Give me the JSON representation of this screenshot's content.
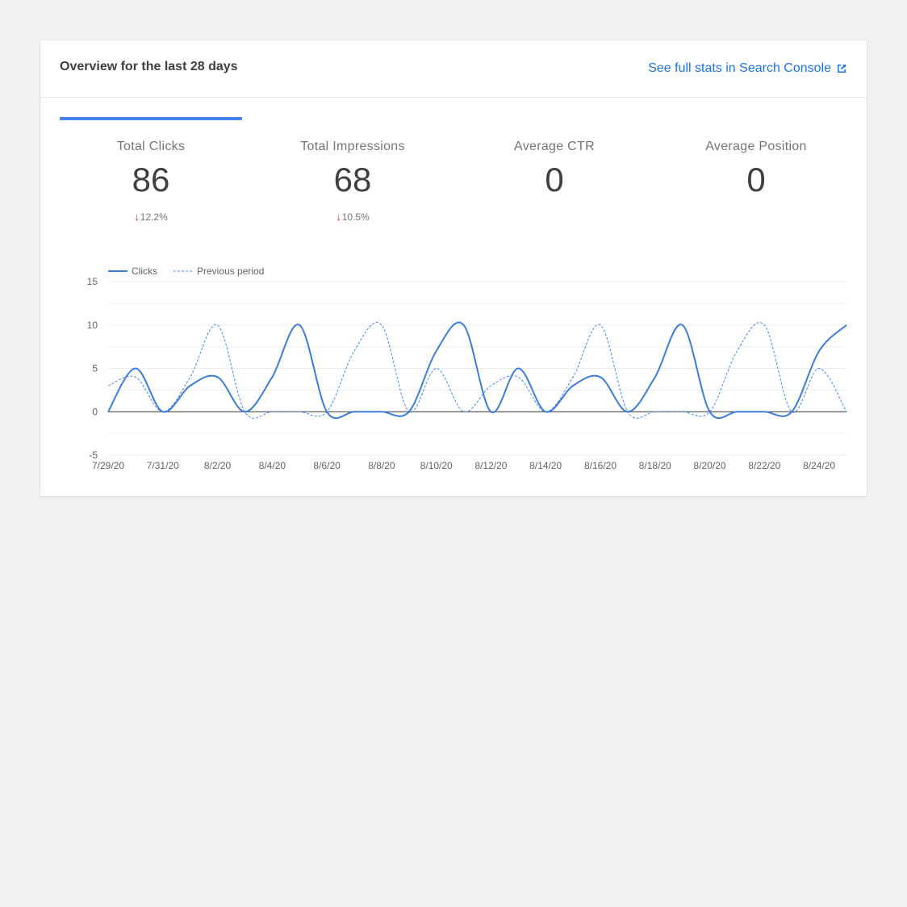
{
  "header": {
    "title": "Overview for the last 28 days",
    "link_label": "See full stats in Search Console",
    "link_icon": "external-link-icon"
  },
  "tabs": [
    {
      "label": "Total Clicks",
      "value": "86",
      "change": "12.2%",
      "direction": "down",
      "selected": true
    },
    {
      "label": "Total Impressions",
      "value": "68",
      "change": "10.5%",
      "direction": "down",
      "selected": false
    },
    {
      "label": "Average CTR",
      "value": "0",
      "change": "",
      "direction": "",
      "selected": false
    },
    {
      "label": "Average Position",
      "value": "0",
      "change": "",
      "direction": "",
      "selected": false
    }
  ],
  "colors": {
    "accent": "#4285f4",
    "link": "#1a73e8",
    "down_arrow": "#d93025"
  },
  "chart_data": {
    "type": "line",
    "legend_position": "top-left",
    "grid": true,
    "y_ticks": [
      15,
      10,
      5,
      0,
      -5
    ],
    "ylim": [
      -5,
      15
    ],
    "x_tick_labels": [
      "7/29/20",
      "7/31/20",
      "8/2/20",
      "8/4/20",
      "8/6/20",
      "8/8/20",
      "8/10/20",
      "8/12/20",
      "8/14/20",
      "8/16/20",
      "8/18/20",
      "8/20/20",
      "8/22/20",
      "8/24/20"
    ],
    "x": [
      "7/29/20",
      "7/30/20",
      "7/31/20",
      "8/1/20",
      "8/2/20",
      "8/3/20",
      "8/4/20",
      "8/5/20",
      "8/6/20",
      "8/7/20",
      "8/8/20",
      "8/9/20",
      "8/10/20",
      "8/11/20",
      "8/12/20",
      "8/13/20",
      "8/14/20",
      "8/15/20",
      "8/16/20",
      "8/17/20",
      "8/18/20",
      "8/19/20",
      "8/20/20",
      "8/21/20",
      "8/22/20",
      "8/23/20",
      "8/24/20",
      "8/25/20"
    ],
    "series": [
      {
        "name": "Clicks",
        "style": "solid",
        "values": [
          0,
          5,
          0,
          3,
          4,
          0,
          4,
          10,
          0,
          0,
          0,
          0,
          7,
          10,
          0,
          5,
          0,
          3,
          4,
          0,
          4,
          10,
          0,
          0,
          0,
          0,
          7,
          10
        ]
      },
      {
        "name": "Previous period",
        "style": "dashed",
        "values": [
          3,
          4,
          0,
          4,
          10,
          0,
          0,
          0,
          0,
          7,
          10,
          0,
          5,
          0,
          3,
          4,
          0,
          4,
          10,
          0,
          0,
          0,
          0,
          7,
          10,
          0,
          5,
          0
        ]
      }
    ]
  }
}
